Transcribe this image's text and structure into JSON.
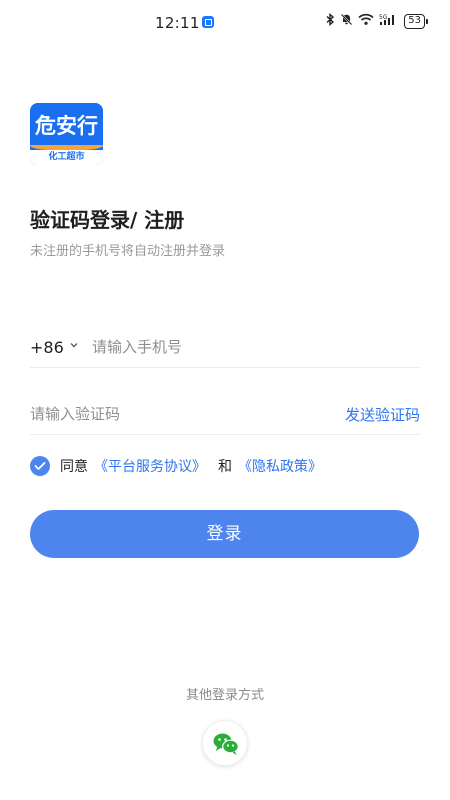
{
  "status_bar": {
    "time": "12:11",
    "battery": "53",
    "signal_label": "5G"
  },
  "logo": {
    "main_text": "危安行",
    "sub_text": "化工超市"
  },
  "header": {
    "title": "验证码登录/ 注册",
    "subtitle": "未注册的手机号将自动注册并登录"
  },
  "phone": {
    "country_code": "+86",
    "placeholder": "请输入手机号",
    "value": ""
  },
  "code": {
    "placeholder": "请输入验证码",
    "value": "",
    "send_label": "发送验证码"
  },
  "agreement": {
    "checked": true,
    "prefix": "同意",
    "link_platform": "《平台服务协议》",
    "conjunction": "和",
    "link_privacy": "《隐私政策》"
  },
  "login_button_label": "登录",
  "other_login": {
    "label": "其他登录方式",
    "icon": "wechat-icon"
  },
  "colors": {
    "accent": "#2f74f0",
    "button": "#4e84ee",
    "logo_blue": "#1a6ff0",
    "logo_orange": "#f3a43a",
    "wechat_green": "#2aae3b"
  }
}
